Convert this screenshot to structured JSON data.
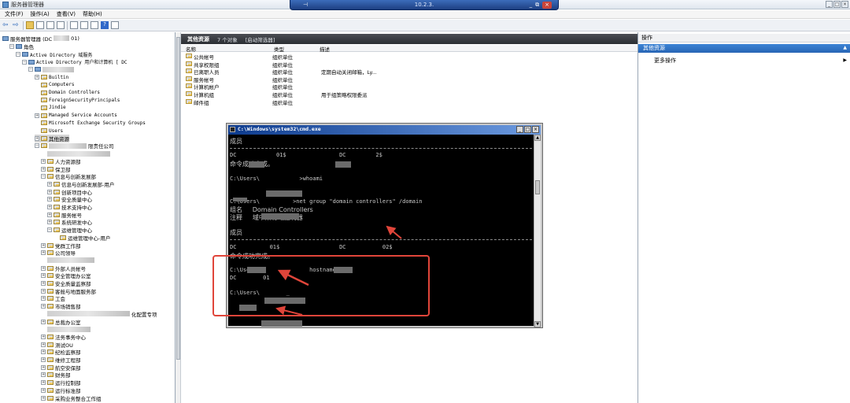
{
  "window": {
    "title": "服务器管理器"
  },
  "rdp": {
    "title": "10.2.3."
  },
  "menu": [
    "文件(F)",
    "操作(A)",
    "查看(V)",
    "帮助(H)"
  ],
  "tree": {
    "root": "服务器管理器 (DC",
    "root_tail": "01)",
    "items": [
      {
        "label": "角色",
        "indent": 1,
        "exp": "−",
        "icon": "srv"
      },
      {
        "label": "Active Directory 域服务",
        "indent": 2,
        "exp": "−",
        "icon": "srv",
        "mono": true
      },
      {
        "label": "Active Directory 用户和计算机 [ DC",
        "indent": 3,
        "exp": "−",
        "icon": "srv",
        "mono": true
      },
      {
        "label": "",
        "indent": 4,
        "exp": "−",
        "icon": "srv",
        "blur": 40
      },
      {
        "label": "Builtin",
        "indent": 5,
        "exp": "+",
        "icon": "ou",
        "mono": true
      },
      {
        "label": "Computers",
        "indent": 5,
        "exp": "",
        "icon": "ou",
        "mono": true
      },
      {
        "label": "Domain Controllers",
        "indent": 5,
        "exp": "",
        "icon": "ou",
        "mono": true
      },
      {
        "label": "ForeignSecurityPrincipals",
        "indent": 5,
        "exp": "",
        "icon": "ou",
        "mono": true
      },
      {
        "label": "Jindie",
        "indent": 5,
        "exp": "",
        "icon": "ou",
        "mono": true
      },
      {
        "label": "Managed Service Accounts",
        "indent": 5,
        "exp": "+",
        "icon": "ou",
        "mono": true
      },
      {
        "label": "Microsoft Exchange Security Groups",
        "indent": 5,
        "exp": "",
        "icon": "ou",
        "mono": true
      },
      {
        "label": "Users",
        "indent": 5,
        "exp": "",
        "icon": "ou",
        "mono": true
      },
      {
        "label": "其他资源",
        "indent": 5,
        "exp": "+",
        "icon": "ou",
        "sel": true
      },
      {
        "label": "限责任公司",
        "indent": 5,
        "exp": "−",
        "icon": "ou",
        "blur": 48
      },
      {
        "label": "",
        "indent": 6,
        "exp": "",
        "icon": "",
        "blur": 80
      },
      {
        "label": "人力资源部",
        "indent": 6,
        "exp": "+",
        "icon": "ou"
      },
      {
        "label": "保卫部",
        "indent": 6,
        "exp": "+",
        "icon": "ou"
      },
      {
        "label": "信息与创新发展部",
        "indent": 6,
        "exp": "−",
        "icon": "ou"
      },
      {
        "label": "信息与创新发展部-用户",
        "indent": 7,
        "exp": "+",
        "icon": "ou"
      },
      {
        "label": "创新项目中心",
        "indent": 7,
        "exp": "+",
        "icon": "ou"
      },
      {
        "label": "安全质量中心",
        "indent": 7,
        "exp": "+",
        "icon": "ou"
      },
      {
        "label": "技术支持中心",
        "indent": 7,
        "exp": "+",
        "icon": "ou"
      },
      {
        "label": "服务帐号",
        "indent": 7,
        "exp": "+",
        "icon": "ou"
      },
      {
        "label": "系统研发中心",
        "indent": 7,
        "exp": "+",
        "icon": "ou"
      },
      {
        "label": "运维管理中心",
        "indent": 7,
        "exp": "−",
        "icon": "ou"
      },
      {
        "label": "运维管理中心-用户",
        "indent": 8,
        "exp": "",
        "icon": "ou"
      },
      {
        "label": "党群工作部",
        "indent": 6,
        "exp": "+",
        "icon": "ou"
      },
      {
        "label": "公司领导",
        "indent": 6,
        "exp": "+",
        "icon": "ou"
      },
      {
        "label": "",
        "indent": 6,
        "exp": "",
        "icon": "",
        "blur": 60
      },
      {
        "label": "外部人员帐号",
        "indent": 6,
        "exp": "+",
        "icon": "ou"
      },
      {
        "label": "安全管理办公室",
        "indent": 6,
        "exp": "+",
        "icon": "ou"
      },
      {
        "label": "安全质量监察部",
        "indent": 6,
        "exp": "+",
        "icon": "ou"
      },
      {
        "label": "客舱与地面服务部",
        "indent": 6,
        "exp": "+",
        "icon": "ou"
      },
      {
        "label": "工会",
        "indent": 6,
        "exp": "+",
        "icon": "ou"
      },
      {
        "label": "市场销售部",
        "indent": 6,
        "exp": "+",
        "icon": "ou"
      },
      {
        "label": "化配置专项",
        "indent": 6,
        "exp": "",
        "icon": "",
        "blur": 105
      },
      {
        "label": "总裁办公室",
        "indent": 6,
        "exp": "+",
        "icon": "ou"
      },
      {
        "label": "",
        "indent": 6,
        "exp": "",
        "icon": "",
        "blur": 55
      },
      {
        "label": "法务事务中心",
        "indent": 6,
        "exp": "+",
        "icon": "ou"
      },
      {
        "label": "测试OU",
        "indent": 6,
        "exp": "+",
        "icon": "ou"
      },
      {
        "label": "纪检监察部",
        "indent": 6,
        "exp": "+",
        "icon": "ou"
      },
      {
        "label": "维修工程部",
        "indent": 6,
        "exp": "+",
        "icon": "ou"
      },
      {
        "label": "航空安保部",
        "indent": 6,
        "exp": "+",
        "icon": "ou"
      },
      {
        "label": "财务部",
        "indent": 6,
        "exp": "+",
        "icon": "ou"
      },
      {
        "label": "运行控制部",
        "indent": 6,
        "exp": "+",
        "icon": "ou"
      },
      {
        "label": "运行标准部",
        "indent": 6,
        "exp": "+",
        "icon": "ou"
      },
      {
        "label": "采购业务整合工作组",
        "indent": 6,
        "exp": "+",
        "icon": "ou"
      }
    ]
  },
  "list": {
    "title": "其他资源",
    "count": "7 个对象",
    "filter": "[启动筛选器]",
    "columns": [
      "名称",
      "类型",
      "描述"
    ],
    "rows": [
      {
        "name": "公共帐号",
        "type": "组织单位",
        "desc": ""
      },
      {
        "name": "共享权限组",
        "type": "组织单位",
        "desc": ""
      },
      {
        "name": "已离职人员",
        "type": "组织单位",
        "desc": "定期自动关闭邮箱，Ly..."
      },
      {
        "name": "服务帐号",
        "type": "组织单位",
        "desc": ""
      },
      {
        "name": "计算机帐户",
        "type": "组织单位",
        "desc": ""
      },
      {
        "name": "计算机组",
        "type": "组织单位",
        "desc": "用于组策略权限委派"
      },
      {
        "name": "邮件组",
        "type": "组织单位",
        "desc": ""
      }
    ]
  },
  "actions": {
    "header": "操作",
    "section": "其他资源",
    "more": "更多操作"
  },
  "cmd": {
    "title": "C:\\Windows\\system32\\cmd.exe",
    "lines": [
      {
        "text": "成员",
        "cjk": true
      },
      {
        "text": "",
        "dash": true
      },
      {
        "text": "DC            01$                DC         2$"
      },
      {
        "text": "命令成功完成。",
        "cjk": true
      },
      {
        "text": ""
      },
      {
        "text": "C:\\Users\\            >whoami"
      },
      {
        "text": ""
      },
      {
        "text": ""
      },
      {
        "text": "C:\\Users\\          >net group \"domain controllers\" /domain"
      },
      {
        "text": "组名     Domain Controllers",
        "cjk": true
      },
      {
        "text": "注释     域中所有域控制器",
        "cjk": true
      },
      {
        "text": ""
      },
      {
        "text": "成员",
        "cjk": true
      },
      {
        "text": "",
        "dash": true
      },
      {
        "text": "DC          01$                  DC           02$"
      },
      {
        "text": "命令成功完成。",
        "cjk": true
      },
      {
        "text": ""
      },
      {
        "text": "C:\\Users\\               hostname"
      },
      {
        "text": "DC        01"
      },
      {
        "text": ""
      },
      {
        "text": "C:\\Users\\        _"
      }
    ]
  },
  "colors": {
    "highlight": "#e0453a",
    "selection": "#2865b4",
    "console_bg": "#000000",
    "console_fg": "#c8c8c8"
  }
}
